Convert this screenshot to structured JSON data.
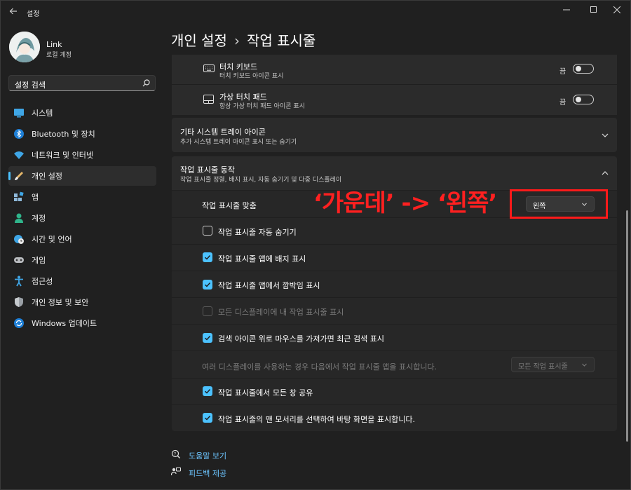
{
  "window": {
    "title": "설정"
  },
  "user": {
    "name": "Link",
    "account": "로컬 계정"
  },
  "search": {
    "placeholder": "설정 검색"
  },
  "sidebar": {
    "items": [
      {
        "label": "시스템",
        "icon": "monitor-icon"
      },
      {
        "label": "Bluetooth 및 장치",
        "icon": "bluetooth-icon"
      },
      {
        "label": "네트워크 및 인터넷",
        "icon": "wifi-icon"
      },
      {
        "label": "개인 설정",
        "icon": "brush-icon",
        "active": true
      },
      {
        "label": "앱",
        "icon": "apps-icon"
      },
      {
        "label": "계정",
        "icon": "person-icon"
      },
      {
        "label": "시간 및 언어",
        "icon": "clock-globe-icon"
      },
      {
        "label": "게임",
        "icon": "gamepad-icon"
      },
      {
        "label": "접근성",
        "icon": "accessibility-icon"
      },
      {
        "label": "개인 정보 및 보안",
        "icon": "shield-icon"
      },
      {
        "label": "Windows 업데이트",
        "icon": "update-icon"
      }
    ]
  },
  "header": {
    "crumb1": "개인 설정",
    "separator": "›",
    "crumb2": "작업 표시줄"
  },
  "tray": {
    "touch_keyboard": {
      "label": "터치 키보드",
      "sub": "터치 키보드 아이콘 표시",
      "state": "끔"
    },
    "touchpad": {
      "label": "가상 터치 패드",
      "sub": "항상 가상 터치 패드 아이콘 표시",
      "state": "끔"
    }
  },
  "other_tray": {
    "label": "기타 시스템 트레이 아이콘",
    "sub": "추가 시스템 트레이 아이콘 표시 또는 숨기기"
  },
  "behaviors": {
    "label": "작업 표시줄 동작",
    "sub": "작업 표시줄 정렬, 배지 표시, 자동 숨기기 및 다중 디스플레이",
    "alignment": {
      "label": "작업 표시줄 맞춤",
      "value": "왼쪽"
    },
    "options": [
      {
        "label": "작업 표시줄 자동 숨기기",
        "checked": false,
        "disabled": false
      },
      {
        "label": "작업 표시줄 앱에 배지 표시",
        "checked": true,
        "disabled": false
      },
      {
        "label": "작업 표시줄 앱에서 깜박임 표시",
        "checked": true,
        "disabled": false
      },
      {
        "label": "모든 디스플레이에 내 작업 표시줄 표시",
        "checked": false,
        "disabled": true
      },
      {
        "label": "검색 아이콘 위로 마우스를 가져가면 최근 검색 표시",
        "checked": true,
        "disabled": false
      }
    ],
    "multi_display": {
      "label": "여러 디스플레이를 사용하는 경우 다음에서 작업 표시줄 앱을 표시합니다.",
      "value": "모든 작업 표시줄"
    },
    "options2": [
      {
        "label": "작업 표시줄에서 모든 창 공유",
        "checked": true
      },
      {
        "label": "작업 표시줄의 맨 모서리를 선택하여 바탕 화면을 표시합니다.",
        "checked": true
      }
    ]
  },
  "annotation": {
    "text": "‘가운데’ -> ‘왼쪽’",
    "color": "#ff1a1a"
  },
  "footer": {
    "help": "도움말 보기",
    "feedback": "피드백 제공"
  },
  "colors": {
    "accent": "#4cc2ff",
    "background": "#202020",
    "card": "#2b2b2b",
    "link": "#6cc5ff"
  }
}
